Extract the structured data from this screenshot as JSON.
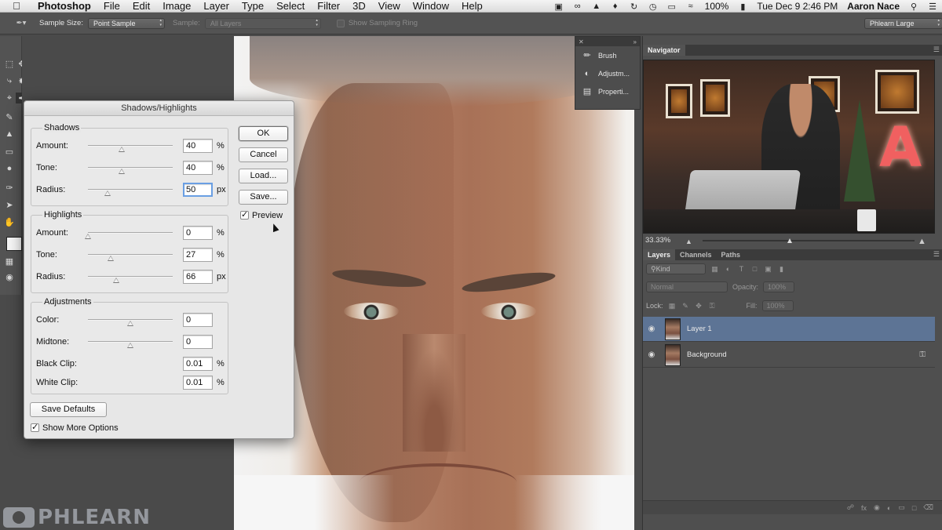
{
  "menubar": {
    "app_name": "Photoshop",
    "items": [
      "File",
      "Edit",
      "Image",
      "Layer",
      "Type",
      "Select",
      "Filter",
      "3D",
      "View",
      "Window",
      "Help"
    ],
    "battery": "100%",
    "datetime": "Tue Dec 9  2:46 PM",
    "user": "Aaron Nace"
  },
  "options_bar": {
    "sample_size_label": "Sample Size:",
    "sample_size_value": "Point Sample",
    "sample_label": "Sample:",
    "sample_value": "All Layers",
    "sampling_ring_label": "Show Sampling Ring",
    "workspace": "Phlearn Large"
  },
  "dialog": {
    "title": "Shadows/Highlights",
    "shadows": {
      "label": "Shadows",
      "amount": {
        "label": "Amount:",
        "value": "40",
        "unit": "%",
        "level": 0.4
      },
      "tone": {
        "label": "Tone:",
        "value": "40",
        "unit": "%",
        "level": 0.4
      },
      "radius": {
        "label": "Radius:",
        "value": "50",
        "unit": "px",
        "level": 0.23
      }
    },
    "highlights": {
      "label": "Highlights",
      "amount": {
        "label": "Amount:",
        "value": "0",
        "unit": "%",
        "level": 0.0
      },
      "tone": {
        "label": "Tone:",
        "value": "27",
        "unit": "%",
        "level": 0.27
      },
      "radius": {
        "label": "Radius:",
        "value": "66",
        "unit": "px",
        "level": 0.33
      }
    },
    "adjustments": {
      "label": "Adjustments",
      "color": {
        "label": "Color:",
        "value": "0",
        "level": 0.5
      },
      "midtone": {
        "label": "Midtone:",
        "value": "0",
        "level": 0.5
      },
      "black_clip": {
        "label": "Black Clip:",
        "value": "0.01",
        "unit": "%"
      },
      "white_clip": {
        "label": "White Clip:",
        "value": "0.01",
        "unit": "%"
      }
    },
    "buttons": {
      "ok": "OK",
      "cancel": "Cancel",
      "load": "Load...",
      "save": "Save...",
      "save_defaults": "Save Defaults"
    },
    "preview_label": "Preview",
    "show_more_label": "Show More Options",
    "preview_checked": true,
    "show_more_checked": true
  },
  "mini_panel": {
    "items": [
      "Brush",
      "Adjustm...",
      "Properti..."
    ]
  },
  "navigator": {
    "tab": "Navigator",
    "zoom": "33.33%"
  },
  "layers_panel": {
    "tabs": [
      "Layers",
      "Channels",
      "Paths"
    ],
    "kind_label": "Kind",
    "blend_mode": "Normal",
    "opacity_label": "Opacity:",
    "opacity_value": "100%",
    "lock_label": "Lock:",
    "fill_label": "Fill:",
    "fill_value": "100%",
    "layers": [
      {
        "name": "Layer 1",
        "selected": true,
        "locked": false
      },
      {
        "name": "Background",
        "selected": false,
        "locked": true
      }
    ]
  },
  "watermark": "PHLEARN",
  "colors": {
    "selection": "#5d7495",
    "panel": "#4f4f4f",
    "dialog": "#e7e7e7",
    "focus": "#6a9fe3"
  }
}
